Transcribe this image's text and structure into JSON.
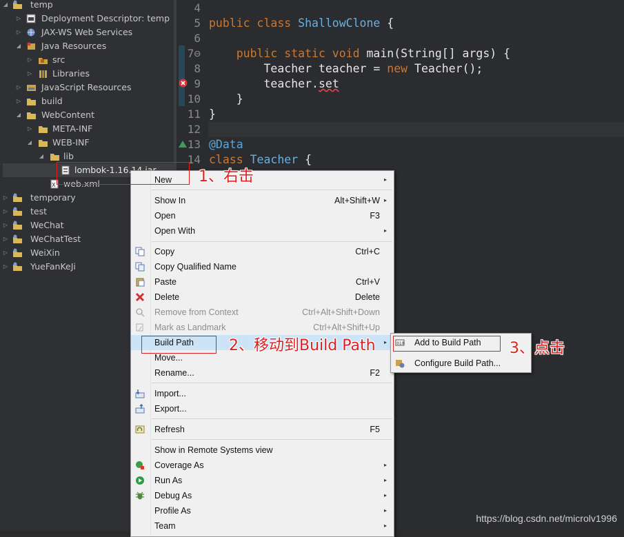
{
  "explorer": {
    "items": [
      {
        "label": "temp",
        "arrow": "◢",
        "icon": "project-icon"
      },
      {
        "label": "Deployment Descriptor: temp",
        "arrow": "▷",
        "icon": "descriptor-icon"
      },
      {
        "label": "JAX-WS Web Services",
        "arrow": "▷",
        "icon": "webservice-icon"
      },
      {
        "label": "Java Resources",
        "arrow": "◢",
        "icon": "java-resources-icon"
      },
      {
        "label": "src",
        "arrow": "▷",
        "icon": "package-folder-icon"
      },
      {
        "label": "Libraries",
        "arrow": "▷",
        "icon": "libraries-icon"
      },
      {
        "label": "JavaScript Resources",
        "arrow": "▷",
        "icon": "js-resources-icon"
      },
      {
        "label": "build",
        "arrow": "▷",
        "icon": "folder-icon"
      },
      {
        "label": "WebContent",
        "arrow": "◢",
        "icon": "folder-icon"
      },
      {
        "label": "META-INF",
        "arrow": "▷",
        "icon": "folder-icon"
      },
      {
        "label": "WEB-INF",
        "arrow": "◢",
        "icon": "folder-icon"
      },
      {
        "label": "lib",
        "arrow": "◢",
        "icon": "folder-icon"
      },
      {
        "label": "lombok-1.16.14.jar",
        "arrow": "",
        "icon": "jar-icon"
      },
      {
        "label": "web.xml",
        "arrow": "",
        "icon": "xml-file-icon"
      },
      {
        "label": "temporary",
        "arrow": "▷",
        "icon": "project-icon"
      },
      {
        "label": "test",
        "arrow": "▷",
        "icon": "project-icon"
      },
      {
        "label": "WeChat",
        "arrow": "▷",
        "icon": "project-icon"
      },
      {
        "label": "WeChatTest",
        "arrow": "▷",
        "icon": "project-icon"
      },
      {
        "label": "WeiXin",
        "arrow": "▷",
        "icon": "project-icon"
      },
      {
        "label": "YueFanKeJi",
        "arrow": "▷",
        "icon": "project-icon"
      }
    ]
  },
  "editor": {
    "line_numbers": [
      "4",
      "5",
      "6",
      "7⊖",
      "8",
      "9",
      "10",
      "11",
      "12",
      "13",
      "14"
    ],
    "code": {
      "l5": {
        "kw": "public class ",
        "cls": "ShallowClone",
        "rest": " {"
      },
      "l7": {
        "kw": "    public static void ",
        "rest": "main(String[] args) {"
      },
      "l8": {
        "a": "        Teacher teacher = ",
        "kw": "new",
        "b": " Teacher();"
      },
      "l9": {
        "a": "        teacher.",
        "err": "set"
      },
      "l10": "    }",
      "l11": "}",
      "l13": "@Data",
      "l14": {
        "kw": "class ",
        "cls": "Teacher",
        "rest": " {"
      }
    }
  },
  "menu": {
    "items": [
      {
        "label": "New",
        "shortcut": "",
        "submenu": true
      },
      {
        "label": "Show In",
        "shortcut": "Alt+Shift+W",
        "submenu": true
      },
      {
        "label": "Open",
        "shortcut": "F3",
        "submenu": false
      },
      {
        "label": "Open With",
        "shortcut": "",
        "submenu": true
      },
      {
        "label": "Copy",
        "shortcut": "Ctrl+C",
        "submenu": false
      },
      {
        "label": "Copy Qualified Name",
        "shortcut": "",
        "submenu": false
      },
      {
        "label": "Paste",
        "shortcut": "Ctrl+V",
        "submenu": false
      },
      {
        "label": "Delete",
        "shortcut": "Delete",
        "submenu": false
      },
      {
        "label": "Remove from Context",
        "shortcut": "Ctrl+Alt+Shift+Down",
        "submenu": false
      },
      {
        "label": "Mark as Landmark",
        "shortcut": "Ctrl+Alt+Shift+Up",
        "submenu": false
      },
      {
        "label": "Build Path",
        "shortcut": "",
        "submenu": true
      },
      {
        "label": "Move...",
        "shortcut": "",
        "submenu": false
      },
      {
        "label": "Rename...",
        "shortcut": "F2",
        "submenu": false
      },
      {
        "label": "Import...",
        "shortcut": "",
        "submenu": false
      },
      {
        "label": "Export...",
        "shortcut": "",
        "submenu": false
      },
      {
        "label": "Refresh",
        "shortcut": "F5",
        "submenu": false
      },
      {
        "label": "Show in Remote Systems view",
        "shortcut": "",
        "submenu": false
      },
      {
        "label": "Coverage As",
        "shortcut": "",
        "submenu": true
      },
      {
        "label": "Run As",
        "shortcut": "",
        "submenu": true
      },
      {
        "label": "Debug As",
        "shortcut": "",
        "submenu": true
      },
      {
        "label": "Profile As",
        "shortcut": "",
        "submenu": true
      },
      {
        "label": "Team",
        "shortcut": "",
        "submenu": true
      }
    ],
    "submenu_arrow": "▸"
  },
  "submenu": {
    "items": [
      {
        "label": "Add to Build Path"
      },
      {
        "label": "Configure Build Path..."
      }
    ]
  },
  "annotations": {
    "step1": "1、右击",
    "step2": "2、移动到Build Path",
    "step3": "3、点击"
  },
  "watermark": "https://blog.csdn.net/microlv1996",
  "colors": {
    "annotation": "#e02020",
    "keyword": "#cc7832",
    "class_name": "#6ab0e0"
  }
}
